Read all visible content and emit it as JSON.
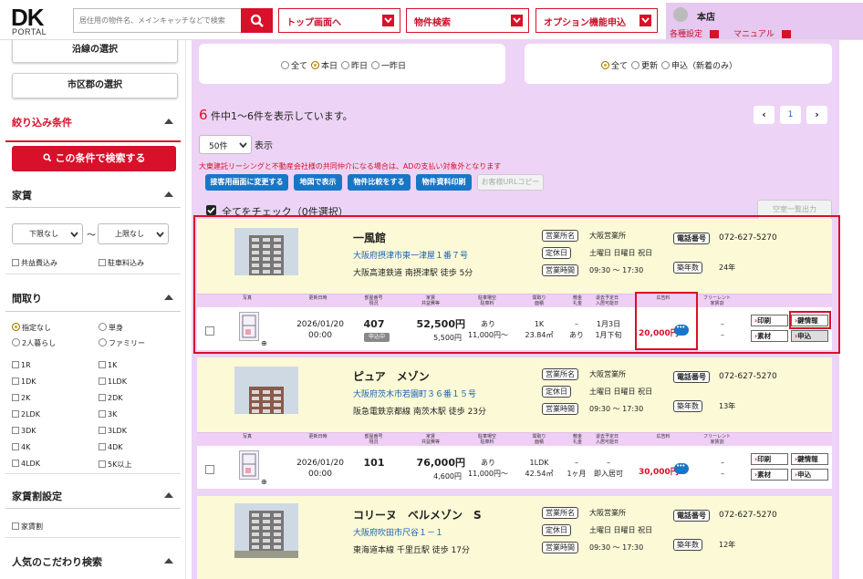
{
  "header": {
    "logo_top": "DK",
    "logo_bottom": "PORTAL",
    "search_placeholder": "居住用の物件名、メインキャッチなどで検索",
    "nav": [
      "トップ画面へ",
      "物件検索",
      "オプション機能申込"
    ],
    "user_name": "本店",
    "settings": "各種設定",
    "manual": "マニュアル"
  },
  "sidebar": {
    "line_select": "沿線の選択",
    "city_select": "市区郡の選択",
    "filter_title": "絞り込み条件",
    "search_btn": "この条件で検索する",
    "rent_title": "家賃",
    "rent_min": "下限なし",
    "rent_sep": "〜",
    "rent_max": "上限なし",
    "rent_opts": [
      "共益費込み",
      "駐車料込み"
    ],
    "layout_title": "間取り",
    "layout_radios": [
      "指定なし",
      "単身",
      "2人暮らし",
      "ファミリー"
    ],
    "layout_checks": [
      "1R",
      "1K",
      "1DK",
      "1LDK",
      "2K",
      "2DK",
      "2LDK",
      "3K",
      "3DK",
      "3LDK",
      "4K",
      "4DK",
      "4LDK",
      "5K以上"
    ],
    "discount_title": "家賃割設定",
    "discount_opt": "家賃割",
    "popular_title": "人気のこだわり検索"
  },
  "filters": {
    "date_options": [
      "全て",
      "本日",
      "昨日",
      "一昨日"
    ],
    "date_selected": "本日",
    "type_options": [
      "全て",
      "更新",
      "申込（新着のみ）"
    ],
    "type_selected": "全て"
  },
  "results": {
    "count": "6",
    "summary": "件中1〜6件を表示しています。",
    "page": "1",
    "per_page": "50件",
    "per_page_suffix": "表示",
    "notice": "大東建託リーシングと不動産会社様の共同仲介になる場合は、ADの支払い対象外となります",
    "actions": [
      "接客用画面に変更する",
      "地図で表示",
      "物件比較をする",
      "物件資料印刷"
    ],
    "copy_url": "お客様URLコピー",
    "check_all": "全てをチェック（0件選択）",
    "vacancy_export": "空室一覧出力"
  },
  "columns": [
    "写真",
    "更新日時",
    "部屋番号\n現況",
    "家賃\n共益費等",
    "駐車場空\n駐車料",
    "間取り\n面積",
    "敷金\n礼金",
    "退去予定日\n入居可能日",
    "広告料",
    "フリーレント\n家賃割"
  ],
  "labels": {
    "office": "営業所名",
    "holiday": "定休日",
    "hours": "営業時間",
    "phone": "電話番号",
    "age": "築年数"
  },
  "row_buttons": {
    "print": "印刷",
    "key": "鍵情報",
    "material": "素材",
    "apply": "申込"
  },
  "properties": [
    {
      "name": "一風館",
      "address": "大阪府摂津市東一津屋１番７号",
      "station": "大阪高速鉄道 南摂津駅 徒歩 5分",
      "office": "大阪営業所",
      "holiday": "土曜日 日曜日 祝日",
      "hours": "09:30 〜 17:30",
      "phone": "072-627-5270",
      "age": "24年",
      "updated_date": "2026/01/20",
      "updated_time": "00:00",
      "room": "407",
      "status": "申込中",
      "rent": "52,500円",
      "fee": "5,500円",
      "parking": "あり",
      "parking_fee": "11,000円〜",
      "layout": "1K",
      "area": "23.84㎡",
      "deposit": "–",
      "key_money": "あり",
      "move_out": "1月3日",
      "move_in": "1月下旬",
      "ad_fee": "20,000円",
      "free_rent": "–",
      "discount": "–"
    },
    {
      "name": "ピュア　メゾン",
      "address": "大阪府茨木市若園町３６番１５号",
      "station": "阪急電鉄京都線 南茨木駅 徒歩 23分",
      "office": "大阪営業所",
      "holiday": "土曜日 日曜日 祝日",
      "hours": "09:30 〜 17:30",
      "phone": "072-627-5270",
      "age": "13年",
      "updated_date": "2026/01/20",
      "updated_time": "00:00",
      "room": "101",
      "status": "",
      "rent": "76,000円",
      "fee": "4,600円",
      "parking": "あり",
      "parking_fee": "11,000円〜",
      "layout": "1LDK",
      "area": "42.54㎡",
      "deposit": "–",
      "key_money": "1ヶ月",
      "move_out": "–",
      "move_in": "即入居可",
      "ad_fee": "30,000円",
      "free_rent": "–",
      "discount": "–"
    },
    {
      "name": "コリーヌ　ベルメゾン　S",
      "address": "大阪府吹田市尺谷１－１",
      "station": "東海道本線 千里丘駅 徒歩 17分",
      "office": "大阪営業所",
      "holiday": "土曜日 日曜日 祝日",
      "hours": "09:30 〜 17:30",
      "phone": "072-627-5270",
      "age": "12年"
    }
  ],
  "colors": {
    "accent": "#d8102a",
    "link": "#1a5fb4",
    "button": "#1976c6",
    "main_bg": "#edd3f5",
    "card_head": "#fbf9d6"
  }
}
